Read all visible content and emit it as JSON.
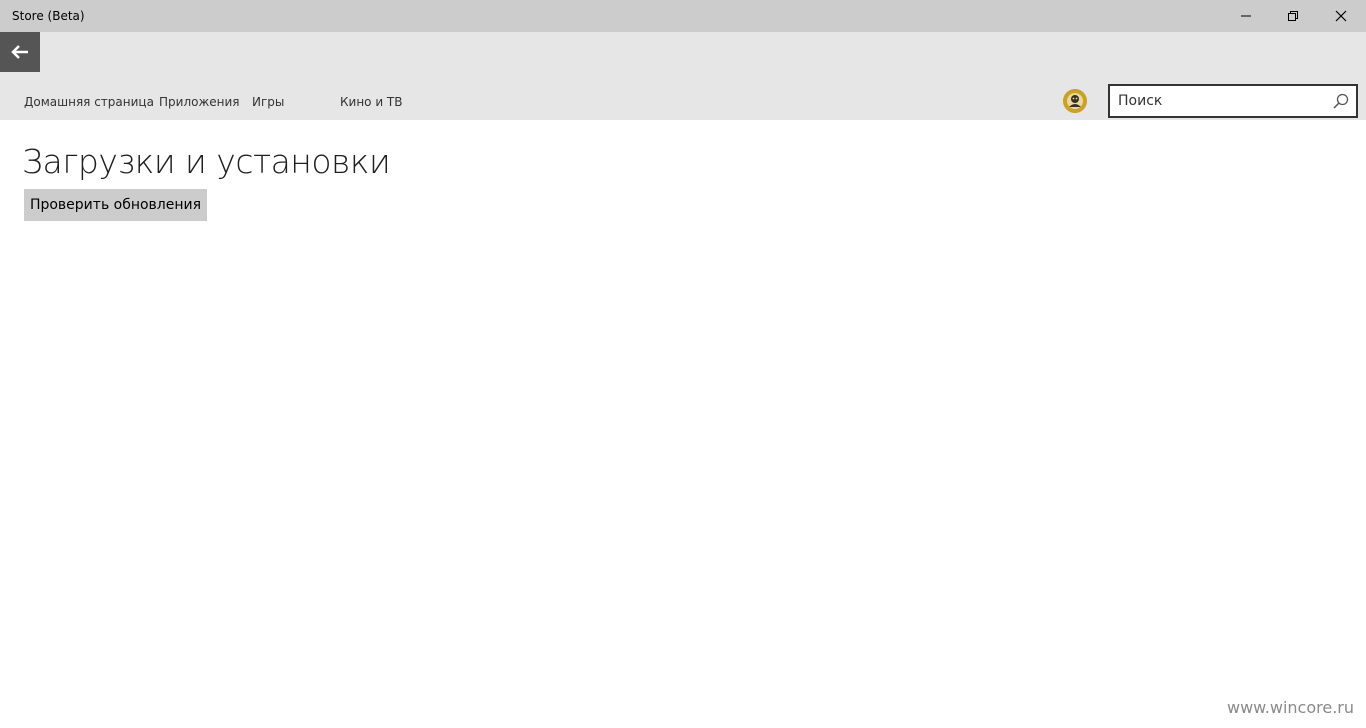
{
  "window": {
    "title": "Store (Beta)",
    "controls": {
      "minimize_icon": "minimize-icon",
      "maximize_icon": "restore-icon",
      "close_icon": "close-icon"
    }
  },
  "header": {
    "back_icon": "back-arrow-icon",
    "nav": {
      "home": "Домашняя страница",
      "apps": "Приложения",
      "games": "Игры",
      "movies": "Кино и ТВ"
    },
    "avatar_icon": "user-avatar",
    "search": {
      "placeholder": "Поиск",
      "icon": "search-icon"
    }
  },
  "main": {
    "title": "Загрузки и установки",
    "check_updates_label": "Проверить обновления"
  },
  "watermark": "www.wincore.ru",
  "colors": {
    "titlebar": "#cccccc",
    "header": "#e6e6e6",
    "back_button": "#555555",
    "button": "#cccccc"
  }
}
